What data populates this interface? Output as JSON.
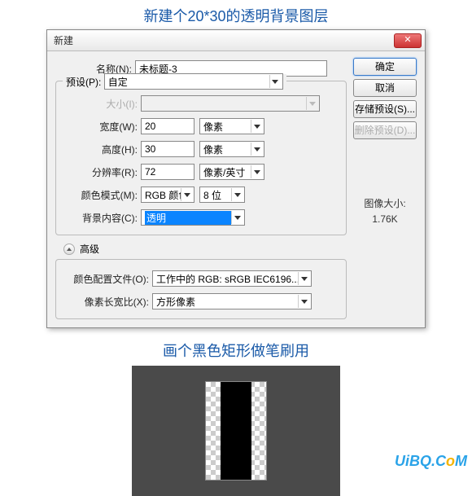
{
  "captions": {
    "top": "新建个20*30的透明背景图层",
    "bottom": "画个黑色矩形做笔刷用"
  },
  "dialog": {
    "title": "新建",
    "closeGlyph": "✕",
    "buttons": {
      "ok": "确定",
      "cancel": "取消",
      "savePreset": "存储预设(S)...",
      "deletePreset": "删除预设(D)..."
    },
    "labels": {
      "name": "名称(N):",
      "preset": "预设(P):",
      "size": "大小(I):",
      "width": "宽度(W):",
      "height": "高度(H):",
      "resolution": "分辨率(R):",
      "colorMode": "颜色模式(M):",
      "background": "背景内容(C):",
      "advanced": "高级",
      "colorProfile": "颜色配置文件(O):",
      "pixelAspect": "像素长宽比(X):",
      "imageSizeLabel": "图像大小:",
      "imageSizeValue": "1.76K"
    },
    "values": {
      "name": "未标题-3",
      "preset": "自定",
      "size": "",
      "width": "20",
      "height": "30",
      "resolution": "72",
      "unitPixels": "像素",
      "unitPPI": "像素/英寸",
      "colorMode": "RGB 颜色",
      "bitDepth": "8 位",
      "background": "透明",
      "colorProfile": "工作中的 RGB: sRGB IEC6196...",
      "pixelAspect": "方形像素"
    }
  },
  "watermark": {
    "u": "U",
    "i": "i",
    "b": "BQ.C",
    "o": "o",
    "m": "M"
  }
}
